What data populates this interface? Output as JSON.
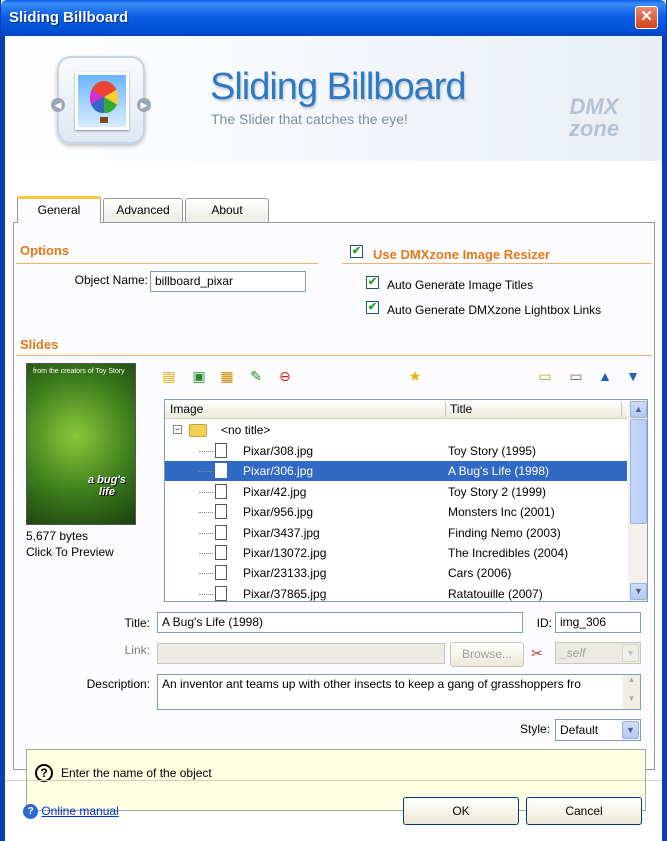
{
  "window": {
    "title": "Sliding Billboard",
    "close_glyph": "✕"
  },
  "banner": {
    "title": "Sliding Billboard",
    "tagline": "The Slider that catches the eye!",
    "brand": "DMX zone",
    "logo_icon": "hot-air-balloon-icon"
  },
  "tabs": [
    {
      "label": "General",
      "active": true
    },
    {
      "label": "Advanced",
      "active": false
    },
    {
      "label": "About",
      "active": false
    }
  ],
  "options": {
    "section_title": "Options",
    "object_name_label": "Object Name:",
    "object_name_value": "billboard_pixar",
    "resizer_label": "Use DMXzone Image Resizer",
    "resizer_checked": true,
    "auto_titles_label": "Auto Generate Image Titles",
    "auto_titles_checked": true,
    "auto_lightbox_label": "Auto Generate DMXzone Lightbox Links",
    "auto_lightbox_checked": true
  },
  "slides": {
    "section_title": "Slides",
    "preview_bytes": "5,677 bytes",
    "preview_hint": "Click To Preview",
    "preview_art_caption": "from the creators of Toy Story",
    "preview_art_title": "a bug's life",
    "columns": {
      "image": "Image",
      "title": "Title"
    },
    "root_label": "<no title>",
    "rows": [
      {
        "image": "Pixar/308.jpg",
        "title": "Toy Story (1995)",
        "selected": false
      },
      {
        "image": "Pixar/306.jpg",
        "title": "A Bug's Life (1998)",
        "selected": true
      },
      {
        "image": "Pixar/42.jpg",
        "title": "Toy Story 2 (1999)",
        "selected": false
      },
      {
        "image": "Pixar/956.jpg",
        "title": "Monsters Inc (2001)",
        "selected": false
      },
      {
        "image": "Pixar/3437.jpg",
        "title": "Finding Nemo (2003)",
        "selected": false
      },
      {
        "image": "Pixar/13072.jpg",
        "title": "The Incredibles (2004)",
        "selected": false
      },
      {
        "image": "Pixar/23133.jpg",
        "title": "Cars (2006)",
        "selected": false
      },
      {
        "image": "Pixar/37865.jpg",
        "title": "Ratatouille (2007)",
        "selected": false
      }
    ],
    "toolbar_icons": [
      "add-images-icon",
      "add-image-icon",
      "edit-image-icon",
      "edit-icon",
      "remove-icon",
      "star-icon",
      "add-folder-icon",
      "delete-folder-icon",
      "move-up-icon",
      "move-down-icon"
    ]
  },
  "details": {
    "title_label": "Title:",
    "title_value": "A Bug's Life (1998)",
    "id_label": "ID:",
    "id_value": "img_306",
    "link_label": "Link:",
    "link_value": "",
    "browse_label": "Browse...",
    "target_value": "_self",
    "description_label": "Description:",
    "description_value": "An inventor ant teams up with other insects to keep a gang of grasshoppers fro",
    "style_label": "Style:",
    "style_value": "Default"
  },
  "help": {
    "text": "Enter the name of the object",
    "glyph": "?"
  },
  "footer": {
    "manual_label": "Online manual",
    "ok_label": "OK",
    "cancel_label": "Cancel"
  },
  "colors": {
    "title_bar": "#0c5fe6",
    "section_accent": "#e07a1a",
    "selection": "#316ac5",
    "help_bg": "#ffffe1"
  }
}
